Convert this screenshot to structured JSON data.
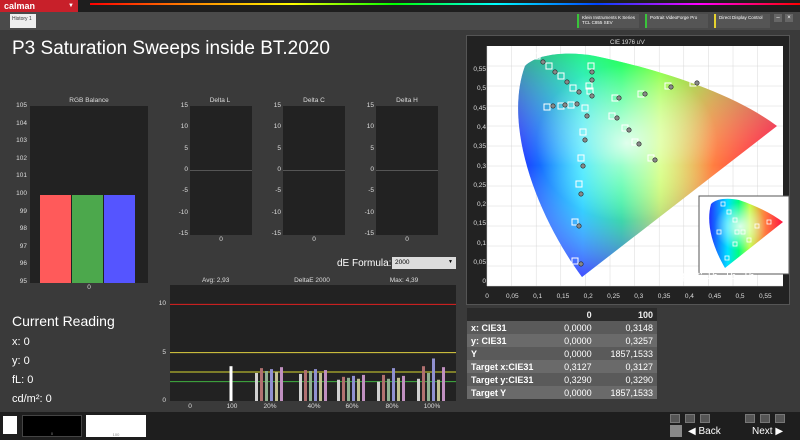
{
  "app": {
    "logo": "calman",
    "tab": "History 1"
  },
  "devices": [
    {
      "name": "Klein Instruments K Series",
      "sub": "TCL C855 SEV",
      "color": "#39c43a"
    },
    {
      "name": "Portrait VideoForge Pro",
      "sub": "",
      "color": "#39c43a"
    },
    {
      "name": "Direct Display Control",
      "sub": "",
      "color": "#e5d12e"
    }
  ],
  "title": "P3 Saturation Sweeps inside BT.2020",
  "rgb_balance": {
    "title": "RGB Balance",
    "yticks": [
      "105",
      "104",
      "103",
      "102",
      "101",
      "100",
      "99",
      "98",
      "97",
      "96",
      "95"
    ],
    "xlabel": "0",
    "bars": [
      {
        "name": "R",
        "value": 100,
        "color": "#ff5a5a"
      },
      {
        "name": "G",
        "value": 100,
        "color": "#4ca84c"
      },
      {
        "name": "B",
        "value": 100,
        "color": "#5555ff"
      }
    ]
  },
  "delta_charts": [
    {
      "title": "Delta L",
      "xlabel": "0"
    },
    {
      "title": "Delta C",
      "xlabel": "0"
    },
    {
      "title": "Delta H",
      "xlabel": "0"
    }
  ],
  "delta_yticks": [
    "15",
    "10",
    "5",
    "0",
    "-5",
    "-10",
    "-15"
  ],
  "de_formula": {
    "label": "dE Formula:",
    "value": "2000"
  },
  "de_chart": {
    "avg": "Avg: 2,93",
    "title": "DeltaE 2000",
    "max": "Max: 4,39",
    "yticks": [
      "10",
      "5",
      "0"
    ],
    "xticks": [
      "0",
      "100",
      "20%",
      "40%",
      "60%",
      "80%",
      "100%"
    ],
    "groups": [
      {
        "x": 0,
        "bars": []
      },
      {
        "x": 100,
        "bars": [
          3.6
        ]
      },
      {
        "x": 20,
        "bars": [
          2.9,
          3.4,
          3.1,
          3.3,
          3.0,
          3.5
        ]
      },
      {
        "x": 40,
        "bars": [
          2.8,
          3.2,
          3.1,
          3.3,
          2.9,
          3.2
        ]
      },
      {
        "x": 60,
        "bars": [
          2.2,
          2.5,
          2.4,
          2.6,
          2.3,
          2.7
        ]
      },
      {
        "x": 80,
        "bars": [
          2.0,
          2.7,
          2.3,
          3.4,
          2.4,
          2.6
        ]
      },
      {
        "x": 100,
        "bars": [
          2.3,
          3.6,
          2.9,
          4.4,
          2.2,
          3.5
        ]
      }
    ],
    "lines": [
      {
        "value": 10,
        "color": "#e02020"
      },
      {
        "value": 5,
        "color": "#e0d040"
      },
      {
        "value": 3,
        "color": "#d8d830"
      },
      {
        "value": 2,
        "color": "#40b040"
      }
    ]
  },
  "current_reading": {
    "title": "Current Reading",
    "lines": [
      "x: 0",
      "y: 0",
      "fL: 0",
      "cd/m²: 0"
    ]
  },
  "cie": {
    "title": "CIE 1976 u'v'",
    "xticks": [
      "0",
      "0,05",
      "0,1",
      "0,15",
      "0,2",
      "0,25",
      "0,3",
      "0,35",
      "0,4",
      "0,45",
      "0,5",
      "0,55"
    ],
    "yticks": [
      "0,55",
      "0,5",
      "0,45",
      "0,4",
      "0,35",
      "0,3",
      "0,25",
      "0,2",
      "0,15",
      "0,1",
      "0,05",
      "0"
    ],
    "triplet": "RGB Triplet: 16, 16, 16"
  },
  "readings_table": {
    "headers": [
      "",
      "0",
      "100"
    ],
    "rows": [
      {
        "label": "x: CIE31",
        "a": "0,0000",
        "b": "0,3148"
      },
      {
        "label": "y: CIE31",
        "a": "0,0000",
        "b": "0,3257"
      },
      {
        "label": "Y",
        "a": "0,0000",
        "b": "1857,1533"
      },
      {
        "label": "Target x:CIE31",
        "a": "0,3127",
        "b": "0,3127"
      },
      {
        "label": "Target y:CIE31",
        "a": "0,3290",
        "b": "0,3290"
      },
      {
        "label": "Target Y",
        "a": "0,0000",
        "b": "1857,1533"
      }
    ]
  },
  "swatches": [
    {
      "label": "0",
      "color": "#000000"
    },
    {
      "label": "100",
      "color": "#ffffff"
    }
  ],
  "nav": {
    "back": "Back",
    "next": "Next"
  }
}
